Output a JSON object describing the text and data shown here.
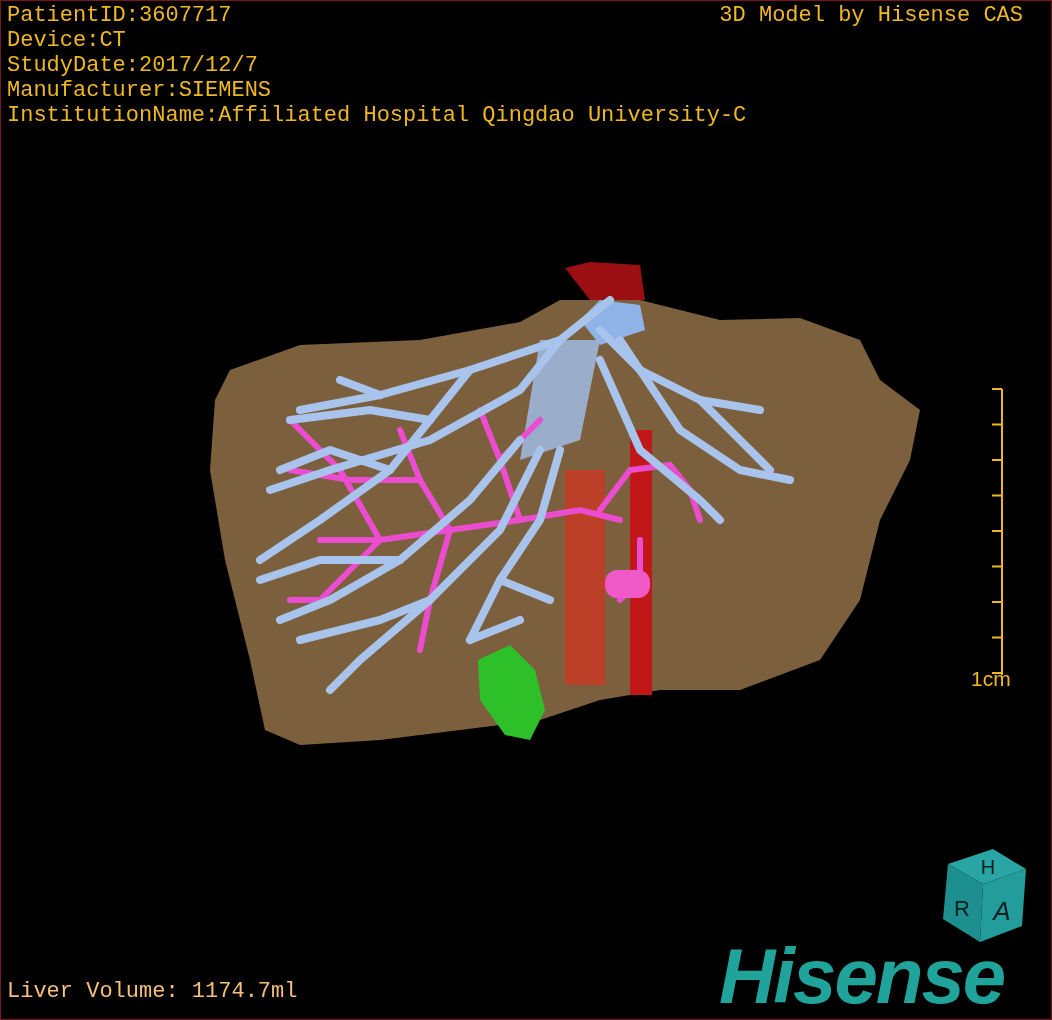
{
  "info_lines": [
    "PatientID:3607717",
    "Device:CT",
    "StudyDate:2017/12/7",
    "Manufacturer:SIEMENS",
    "InstitutionName:Affiliated Hospital Qingdao University-C"
  ],
  "title": "3D Model by Hisense CAS",
  "scale": {
    "label": "1cm"
  },
  "orientation_cube": {
    "faces": [
      "H",
      "R",
      "A"
    ]
  },
  "logo": "Hisense",
  "volume": "Liver Volume: 1174.7ml"
}
